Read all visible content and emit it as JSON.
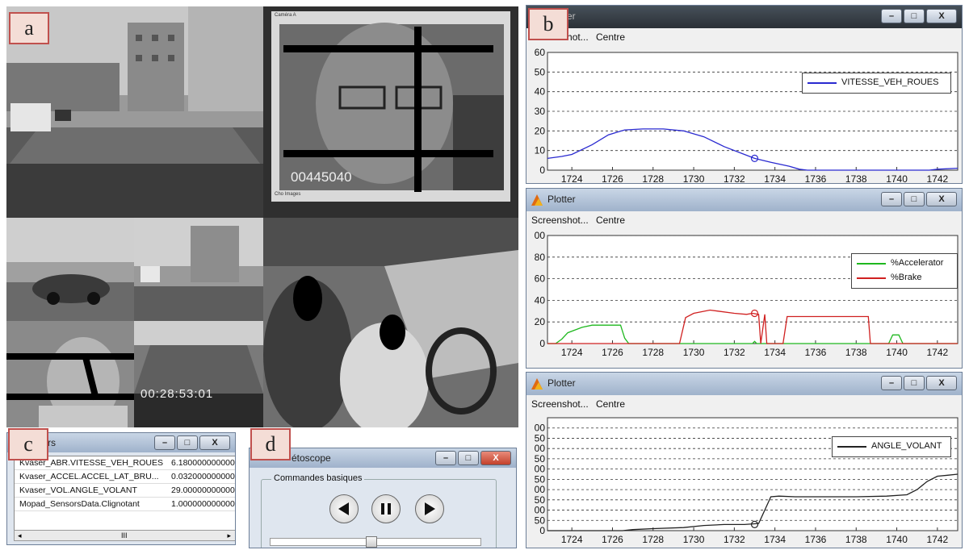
{
  "labels": {
    "a": "a",
    "b": "b",
    "c": "c",
    "d": "d"
  },
  "video": {
    "camera_label": "Caméra A",
    "frame_counter": "00445040",
    "frame_sub": "Cho Images",
    "timecode": "00:28:53:01"
  },
  "plotters": [
    {
      "title": "Plotter",
      "menu": [
        "Screenshot...",
        "Centre"
      ],
      "chart_data": {
        "type": "line",
        "x_ticks": [
          1724,
          1726,
          1728,
          1730,
          1732,
          1734,
          1736,
          1738,
          1740,
          1742
        ],
        "y_ticks": [
          0,
          10,
          20,
          30,
          40,
          50,
          60
        ],
        "xlim": [
          1722.8,
          1743
        ],
        "ylim": [
          0,
          60
        ],
        "grid": "horizontal dashed",
        "legend": "top-right",
        "series": [
          {
            "name": "VITESSE_VEH_ROUES",
            "color": "#2a2ad0",
            "x": [
              1722.8,
              1723.5,
              1724,
              1725,
              1725.8,
              1726.6,
              1727.5,
              1728.5,
              1729.5,
              1730.5,
              1731.5,
              1732.5,
              1733,
              1733.8,
              1734.7,
              1735.2,
              1735.6,
              1741.6,
              1742,
              1743
            ],
            "y": [
              6,
              7,
              8,
              13,
              18,
              20.5,
              21,
              21,
              20,
              17,
              12,
              8,
              6,
              4,
              2,
              0.5,
              0,
              0,
              0.5,
              1
            ]
          }
        ],
        "marker": {
          "x": 1733,
          "y": 6
        }
      }
    },
    {
      "title": "Plotter",
      "menu": [
        "Screenshot...",
        "Centre"
      ],
      "chart_data": {
        "type": "line",
        "x_ticks": [
          1724,
          1726,
          1728,
          1730,
          1732,
          1734,
          1736,
          1738,
          1740,
          1742
        ],
        "y_ticks": [
          0,
          20,
          40,
          60,
          80,
          100
        ],
        "y_tick_labels": [
          "0",
          "20",
          "40",
          "60",
          "80",
          "00"
        ],
        "xlim": [
          1722.8,
          1743
        ],
        "ylim": [
          0,
          100
        ],
        "grid": "horizontal dashed",
        "legend": "top-right",
        "series": [
          {
            "name": "%Accelerator",
            "color": "#1fb81f",
            "x": [
              1722.8,
              1723.2,
              1723.5,
              1723.8,
              1724.5,
              1725,
              1726.4,
              1726.6,
              1726.8,
              1732.9,
              1733,
              1733.1,
              1739.6,
              1739.8,
              1740.1,
              1740.3,
              1743
            ],
            "y": [
              0,
              0,
              4,
              10,
              15,
              17,
              17,
              5,
              0,
              0,
              2,
              0,
              0,
              8,
              8,
              0,
              0
            ]
          },
          {
            "name": "%Brake",
            "color": "#d02020",
            "x": [
              1722.8,
              1729.3,
              1729.6,
              1730,
              1730.8,
              1731.2,
              1732,
              1732.6,
              1732.9,
              1733.2,
              1733.3,
              1733.5,
              1733.6,
              1734.4,
              1734.6,
              1738.6,
              1738.7,
              1743
            ],
            "y": [
              0,
              0,
              24,
              28,
              31,
              30,
              28,
              27,
              28,
              27,
              0,
              27,
              0,
              0,
              25,
              25,
              0,
              0
            ]
          }
        ],
        "marker": {
          "x": 1733,
          "y": 28
        }
      }
    },
    {
      "title": "Plotter",
      "menu": [
        "Screenshot...",
        "Centre"
      ],
      "chart_data": {
        "type": "line",
        "x_ticks": [
          1724,
          1726,
          1728,
          1730,
          1732,
          1734,
          1736,
          1738,
          1740,
          1742
        ],
        "y_ticks": [
          0,
          50,
          100,
          150,
          200,
          250,
          300,
          350,
          400,
          450,
          500
        ],
        "y_tick_labels": [
          "0",
          "50",
          "00",
          "50",
          "00",
          "50",
          "00",
          "50",
          "00",
          "50",
          "00"
        ],
        "xlim": [
          1722.8,
          1743
        ],
        "ylim": [
          0,
          550
        ],
        "grid": "horizontal dashed",
        "legend": "top-right",
        "series": [
          {
            "name": "ANGLE_VOLANT",
            "color": "#222222",
            "x": [
              1722.8,
              1724,
              1726.5,
              1727,
              1728,
              1729.5,
              1730.5,
              1731.5,
              1732.5,
              1733.2,
              1733.5,
              1733.8,
              1734.2,
              1735,
              1736,
              1738,
              1739.5,
              1740.5,
              1741,
              1741.5,
              1742,
              1742.5,
              1743
            ],
            "y": [
              0,
              0,
              0,
              5,
              10,
              15,
              25,
              30,
              30,
              35,
              100,
              165,
              168,
              165,
              165,
              165,
              168,
              175,
              200,
              240,
              265,
              270,
              275
            ]
          }
        ],
        "marker": {
          "x": 1733,
          "y": 30
        }
      }
    }
  ],
  "signals": {
    "title": "rs",
    "rows": [
      {
        "name": "Kvaser_ABR.VITESSE_VEH_ROUES",
        "value": "6.180000000000"
      },
      {
        "name": "Kvaser_ACCEL.ACCEL_LAT_BRU...",
        "value": "0.032000000000"
      },
      {
        "name": "Kvaser_VOL.ANGLE_VOLANT",
        "value": "29.000000000000"
      },
      {
        "name": "Mopad_SensorsData.Clignotant",
        "value": "1.000000000000"
      }
    ],
    "scroll_grip": "III",
    "scroll_left": "◂",
    "scroll_right": "▸"
  },
  "magnetoscope": {
    "title": "étoscope",
    "group_label": "Commandes basiques"
  },
  "window_buttons": {
    "minimize": "–",
    "maximize": "□",
    "close": "X"
  }
}
